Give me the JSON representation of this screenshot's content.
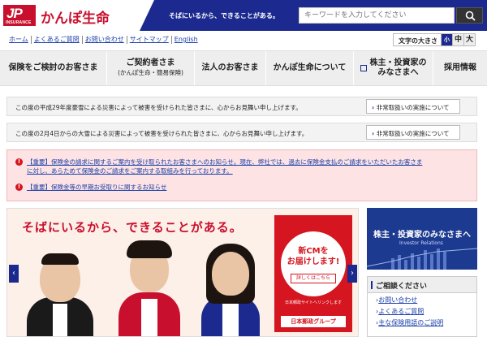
{
  "header": {
    "logo_mark": "JP",
    "logo_sub": "INSURANCE",
    "logo_name": "かんぽ生命",
    "tagline": "そばにいるから、できることがある。",
    "search_placeholder": "キーワードを入力してください",
    "search_icon": "search-icon"
  },
  "util": {
    "links": [
      "ホーム",
      "よくあるご質問",
      "お問い合わせ",
      "サイトマップ",
      "English"
    ],
    "fontsize_label": "文字の大きさ",
    "fontsize_options": [
      "小",
      "中",
      "大"
    ]
  },
  "gnav": {
    "items": [
      {
        "label": "保険をご検討のお客さま",
        "sub": ""
      },
      {
        "label": "ご契約者さま",
        "sub": "(かんぽ生命・簡易保険)"
      },
      {
        "label": "法人のお客さま",
        "sub": ""
      },
      {
        "label": "かんぽ生命について",
        "sub": ""
      },
      {
        "label": "株主・投資家の",
        "sub": "みなさまへ"
      },
      {
        "label": "採用情報",
        "sub": ""
      }
    ]
  },
  "notices": [
    {
      "text": "この度の平成29年度豪雪による災害によって被害を受けられた皆さまに、心からお見舞い申し上げます。",
      "button": "非常取扱いの実施について"
    },
    {
      "text": "この度の2月4日からの大雪による災害によって被害を受けられた皆さまに、心からお見舞い申し上げます。",
      "button": "非常取扱いの実施について"
    }
  ],
  "alerts": [
    {
      "line1": "【重要】保険金の請求に関するご案内を受け取られたお客さまへのお知らせ。現在、弊社では、過去に保険金支払のご請求をいただいたお客さま",
      "line2": "に対し、あらためて保険金のご請求をご案内する取組みを行っております。"
    },
    {
      "line1": "【重要】保険金等の早期お受取りに関するお知らせ",
      "line2": ""
    }
  ],
  "hero": {
    "copy": "そばにいるから、できることがある。",
    "cm_title_1": "新CMを",
    "cm_title_2": "お届けします!",
    "cm_more": "詳しくはこちら",
    "cm_site": "日本郵政サイトへリンクします",
    "cm_brand": "日本郵政グループ"
  },
  "ir_banner": {
    "title": "株主・投資家のみなさまへ",
    "subtitle": "Investor Relations"
  },
  "consult": {
    "title": "ご相談ください",
    "items": [
      "お問い合わせ",
      "よくあるご質問",
      "主な保険用語のご説明"
    ]
  },
  "colors": {
    "brand_red": "#c8102e",
    "brand_navy": "#1c2a8f",
    "alert_bg": "#fde3e4"
  }
}
